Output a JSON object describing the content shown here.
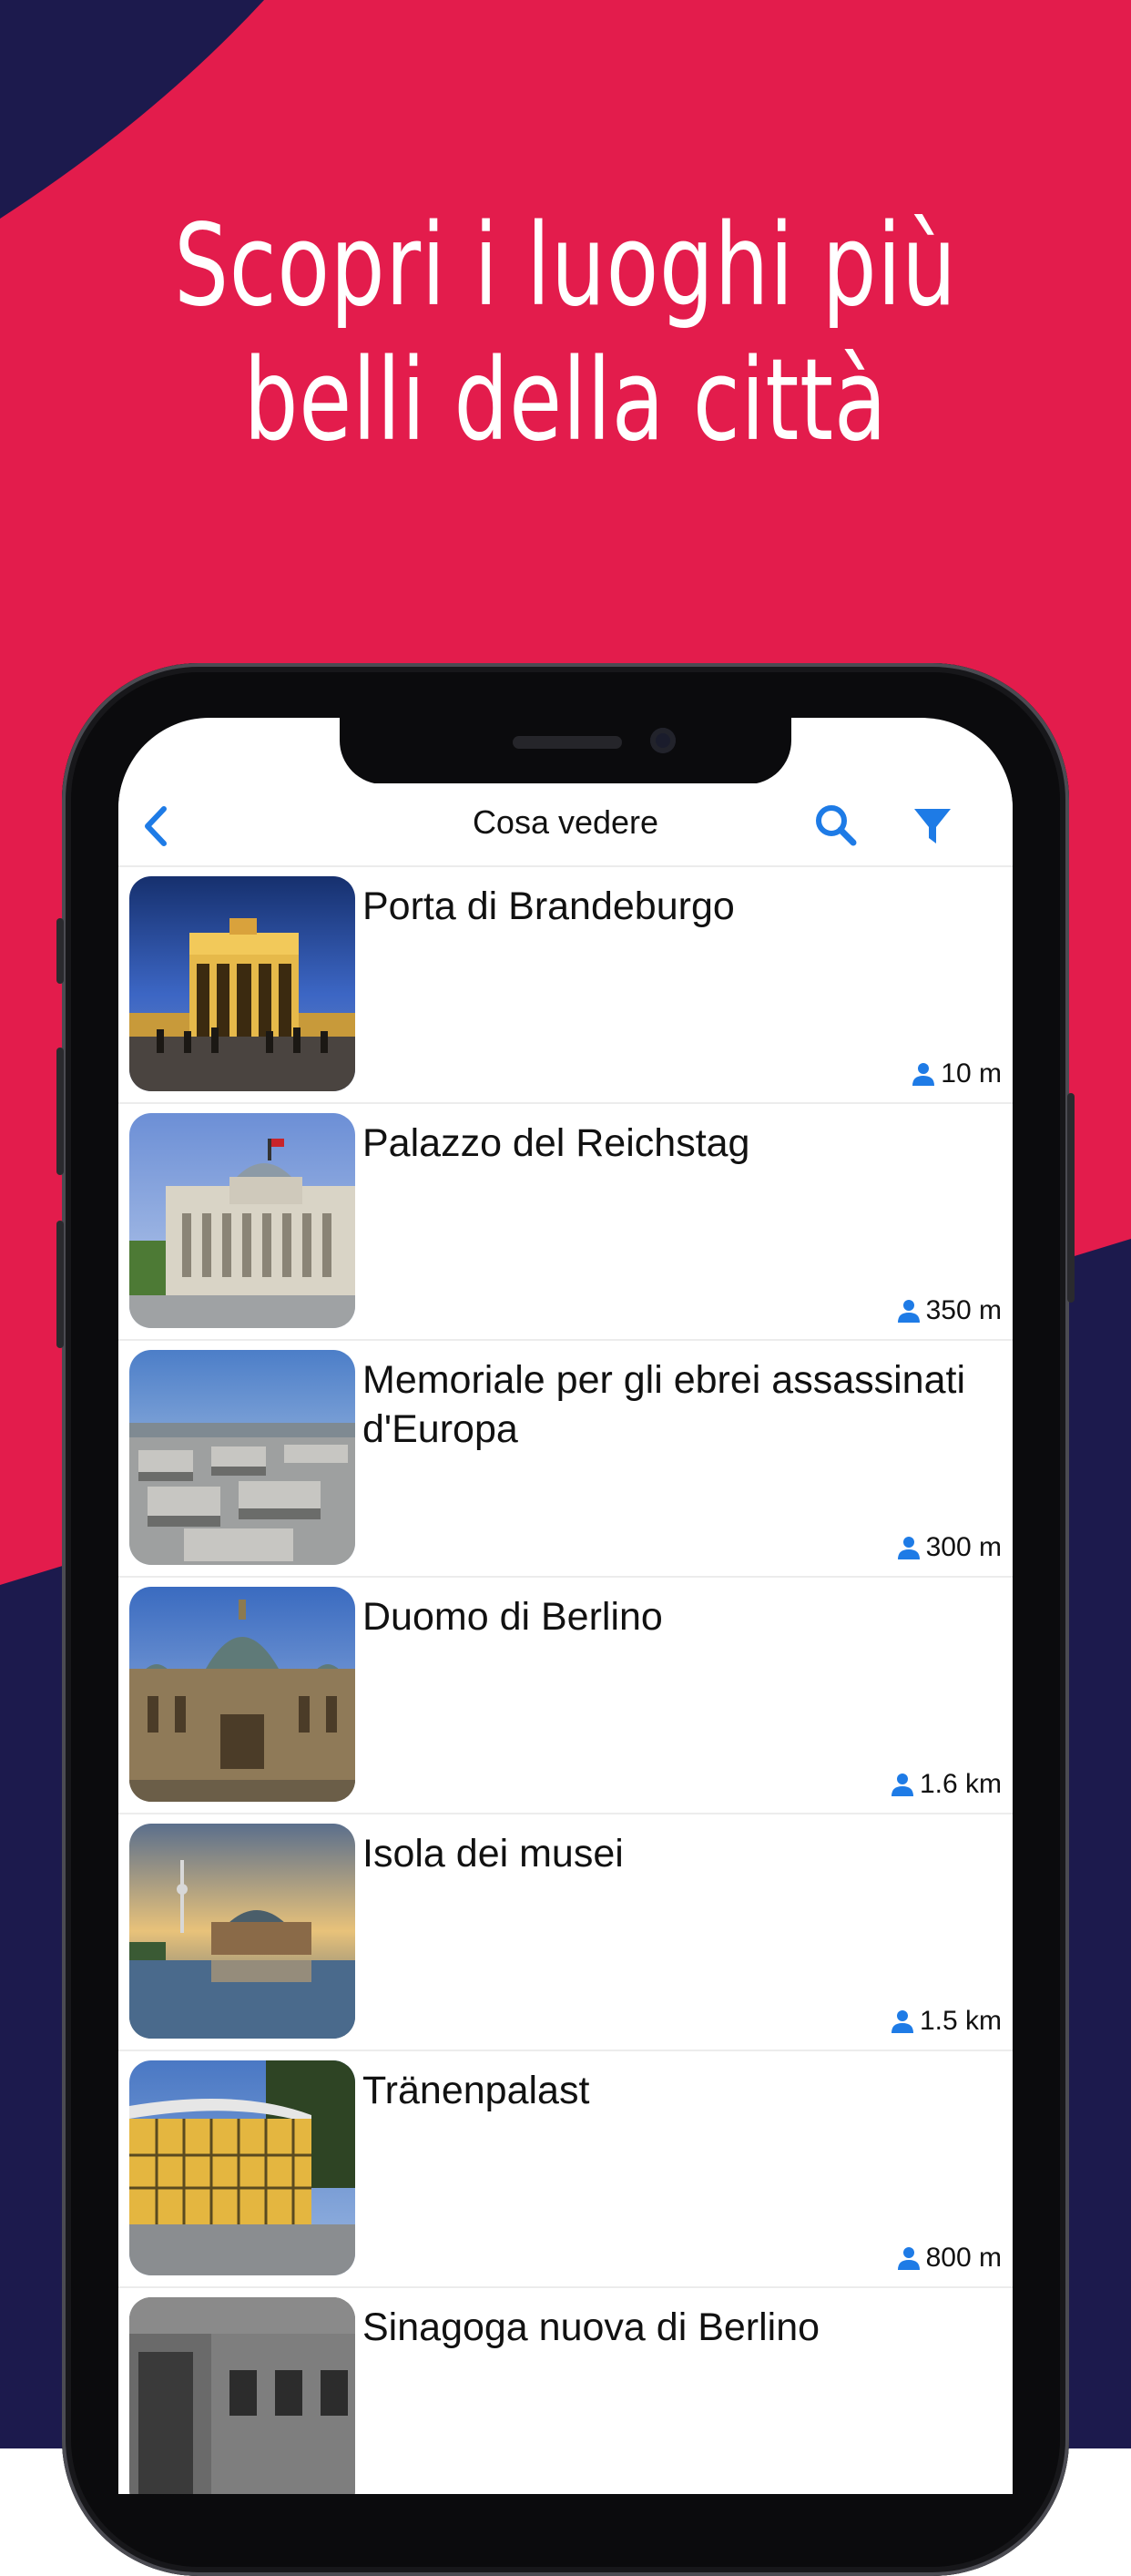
{
  "headline": {
    "line1": "Scopri i luoghi più",
    "line2": "belli della città"
  },
  "colors": {
    "primary": "#e31c4c",
    "navy": "#1c1a4d",
    "accent": "#1e7be6"
  },
  "navbar": {
    "title": "Cosa vedere",
    "back_icon": "chevron-left-icon",
    "search_icon": "search-icon",
    "filter_icon": "filter-icon"
  },
  "places": [
    {
      "title": "Porta di Brandeburgo",
      "distance": "10 m"
    },
    {
      "title": "Palazzo del Reichstag",
      "distance": "350 m"
    },
    {
      "title": "Memoriale per gli ebrei assassinati d'Europa",
      "distance": "300 m"
    },
    {
      "title": "Duomo di Berlino",
      "distance": "1.6 km"
    },
    {
      "title": "Isola dei musei",
      "distance": "1.5 km"
    },
    {
      "title": "Tränenpalast",
      "distance": "800 m"
    },
    {
      "title": "Sinagoga nuova di Berlino",
      "distance": ""
    }
  ]
}
